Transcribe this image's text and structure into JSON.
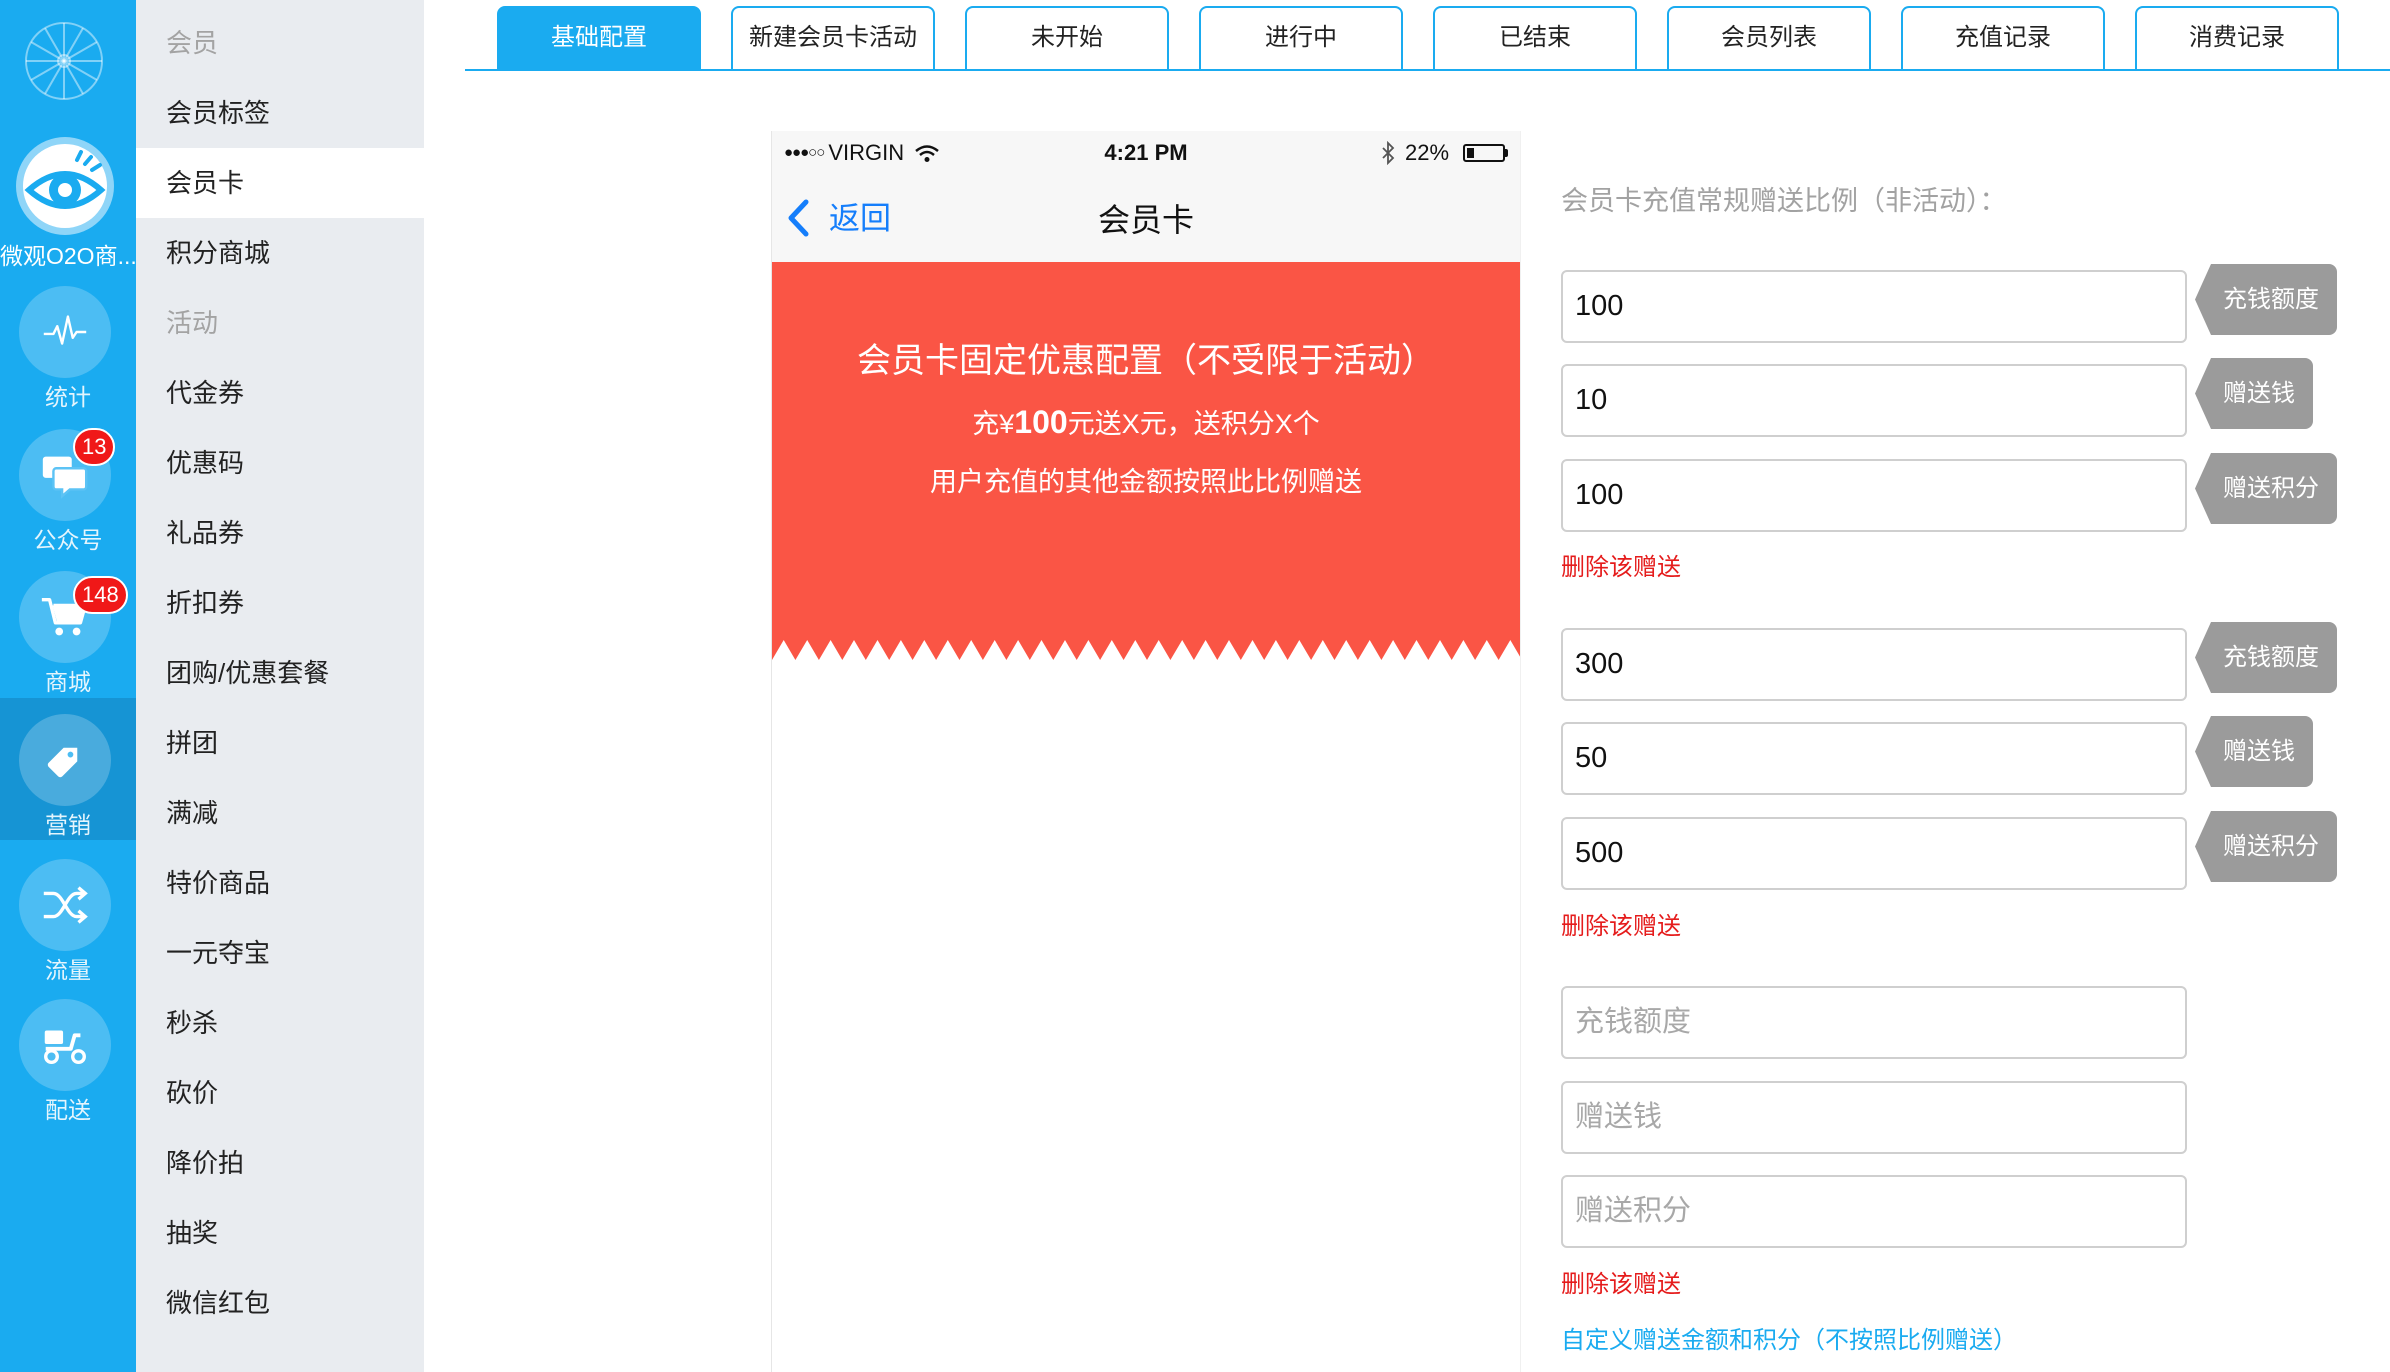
{
  "app": {
    "name": "微观O2O商...",
    "logo_icon": "wheel-icon",
    "app_icon": "eye-logo-icon",
    "brand_color": "#1aabf0"
  },
  "rail": {
    "items": [
      {
        "label": "统计",
        "icon": "pulse-icon"
      },
      {
        "label": "公众号",
        "icon": "chat-icon",
        "badge": "13"
      },
      {
        "label": "商城",
        "icon": "cart-icon",
        "badge": "148"
      },
      {
        "label": "营销",
        "icon": "tag-icon",
        "active": true
      },
      {
        "label": "流量",
        "icon": "shuffle-icon"
      },
      {
        "label": "配送",
        "icon": "scooter-icon"
      }
    ]
  },
  "menu": {
    "items": [
      {
        "label": "会员",
        "is_header": true
      },
      {
        "label": "会员标签"
      },
      {
        "label": "会员卡",
        "active": true
      },
      {
        "label": "积分商城"
      },
      {
        "label": "活动",
        "is_header": true
      },
      {
        "label": "代金券"
      },
      {
        "label": "优惠码"
      },
      {
        "label": "礼品券"
      },
      {
        "label": "折扣券"
      },
      {
        "label": "团购/优惠套餐"
      },
      {
        "label": "拼团"
      },
      {
        "label": "满减"
      },
      {
        "label": "特价商品"
      },
      {
        "label": "一元夺宝"
      },
      {
        "label": "秒杀"
      },
      {
        "label": "砍价"
      },
      {
        "label": "降价拍"
      },
      {
        "label": "抽奖"
      },
      {
        "label": "微信红包"
      }
    ]
  },
  "tabs": {
    "items": [
      {
        "label": "基础配置",
        "active": true
      },
      {
        "label": "新建会员卡活动"
      },
      {
        "label": "未开始"
      },
      {
        "label": "进行中"
      },
      {
        "label": "已结束"
      },
      {
        "label": "会员列表"
      },
      {
        "label": "充值记录"
      },
      {
        "label": "消费记录"
      }
    ]
  },
  "phone": {
    "status": {
      "signal": "●●●○○",
      "carrier": "VIRGIN",
      "time": "4:21 PM",
      "battery": "22%"
    },
    "nav": {
      "back": "返回",
      "title": "会员卡",
      "back_color": "#157efb"
    },
    "banner": {
      "title": "会员卡固定优惠配置（不受限于活动）",
      "line2": {
        "prefix": "充¥",
        "amount": "100",
        "suffix": "元送X元，送积分X个"
      },
      "note": "用户充值的其他金额按照此比例赠送",
      "color": "#fa5545"
    }
  },
  "form": {
    "title": "会员卡充值常规赠送比例（非活动）：",
    "groups": [
      {
        "recharge": "100",
        "bonus_money": "10",
        "bonus_points": "100"
      },
      {
        "recharge": "300",
        "bonus_money": "50",
        "bonus_points": "500"
      }
    ],
    "placeholders": {
      "recharge": "充钱额度",
      "bonus_money": "赠送钱",
      "bonus_points": "赠送积分"
    },
    "tags": {
      "recharge": "充钱额度",
      "bonus_money": "赠送钱",
      "bonus_points": "赠送积分"
    },
    "delete_label": "删除该赠送",
    "custom_link": "自定义赠送金额和积分（不按照比例赠送）",
    "delete_color": "#e51c1c"
  }
}
